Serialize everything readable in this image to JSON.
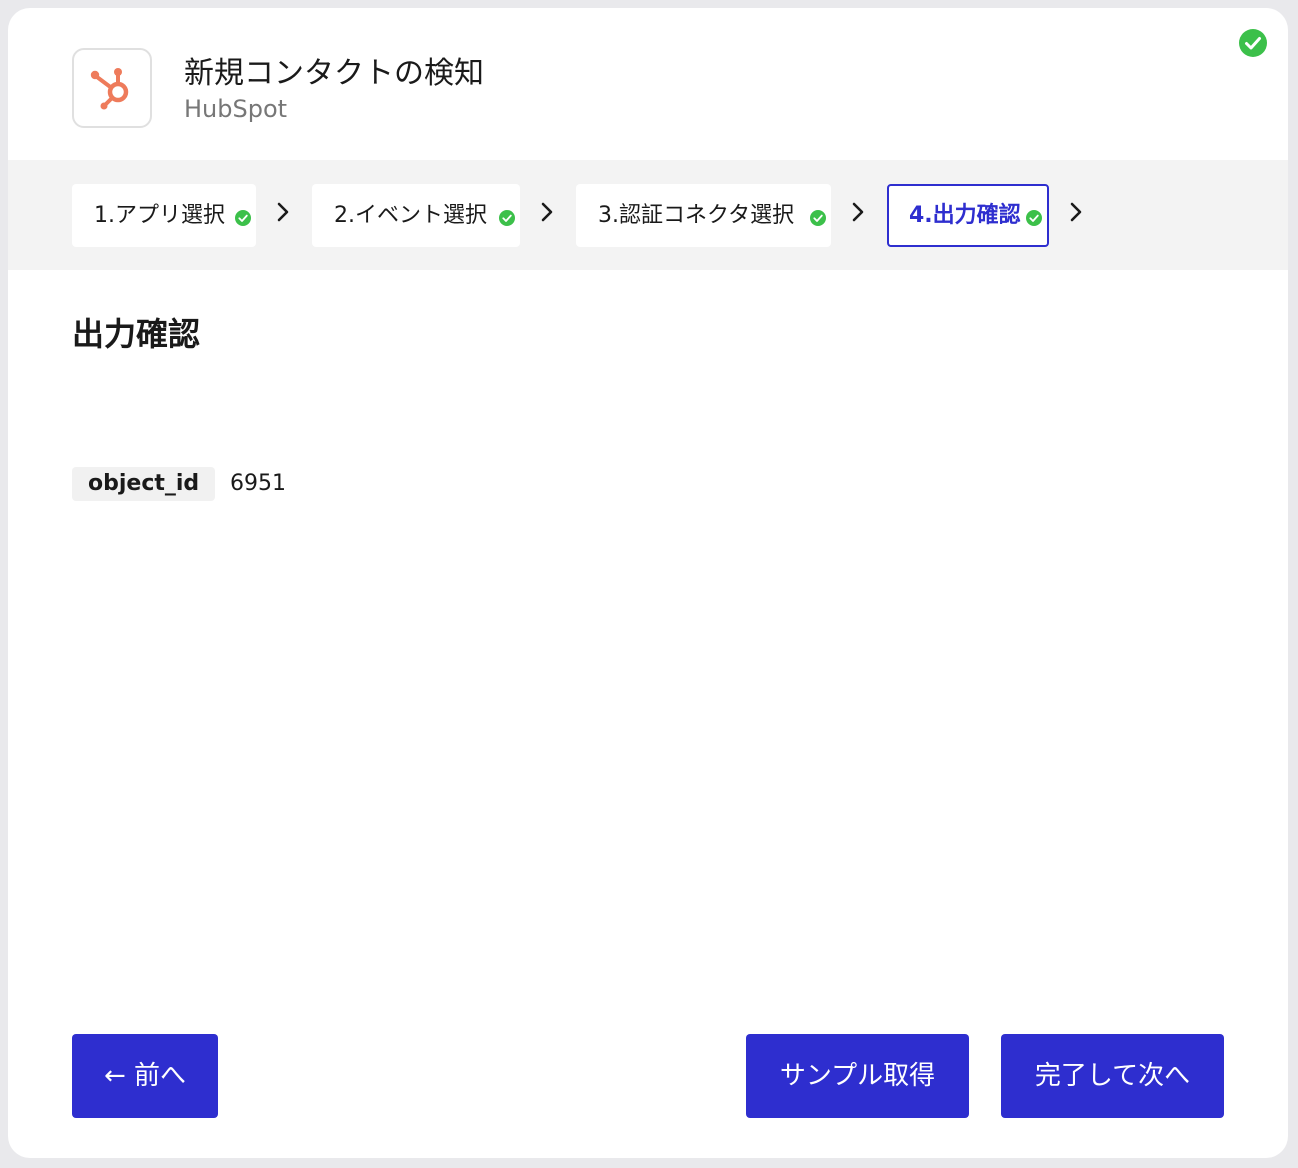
{
  "header": {
    "title": "新規コンタクトの検知",
    "app_name": "HubSpot",
    "app_icon": "hubspot-logo",
    "status_icon": "check-circle-icon"
  },
  "steps": [
    {
      "label": "1.アプリ選択",
      "completed": true,
      "active": false
    },
    {
      "label": "2.イベント選択",
      "completed": true,
      "active": false
    },
    {
      "label": "3.認証コネクタ選択",
      "completed": true,
      "active": false
    },
    {
      "label": "4.出力確認",
      "completed": true,
      "active": true
    }
  ],
  "main": {
    "section_title": "出力確認",
    "fields": [
      {
        "key": "object_id",
        "value": "6951"
      }
    ]
  },
  "footer": {
    "prev_label": "← 前へ",
    "sample_label": "サンプル取得",
    "next_label": "完了して次へ"
  },
  "colors": {
    "accent": "#2e2ecf",
    "success": "#3cc04a",
    "hubspot": "#ee7b5b",
    "stepper_bg": "#f3f3f3"
  }
}
